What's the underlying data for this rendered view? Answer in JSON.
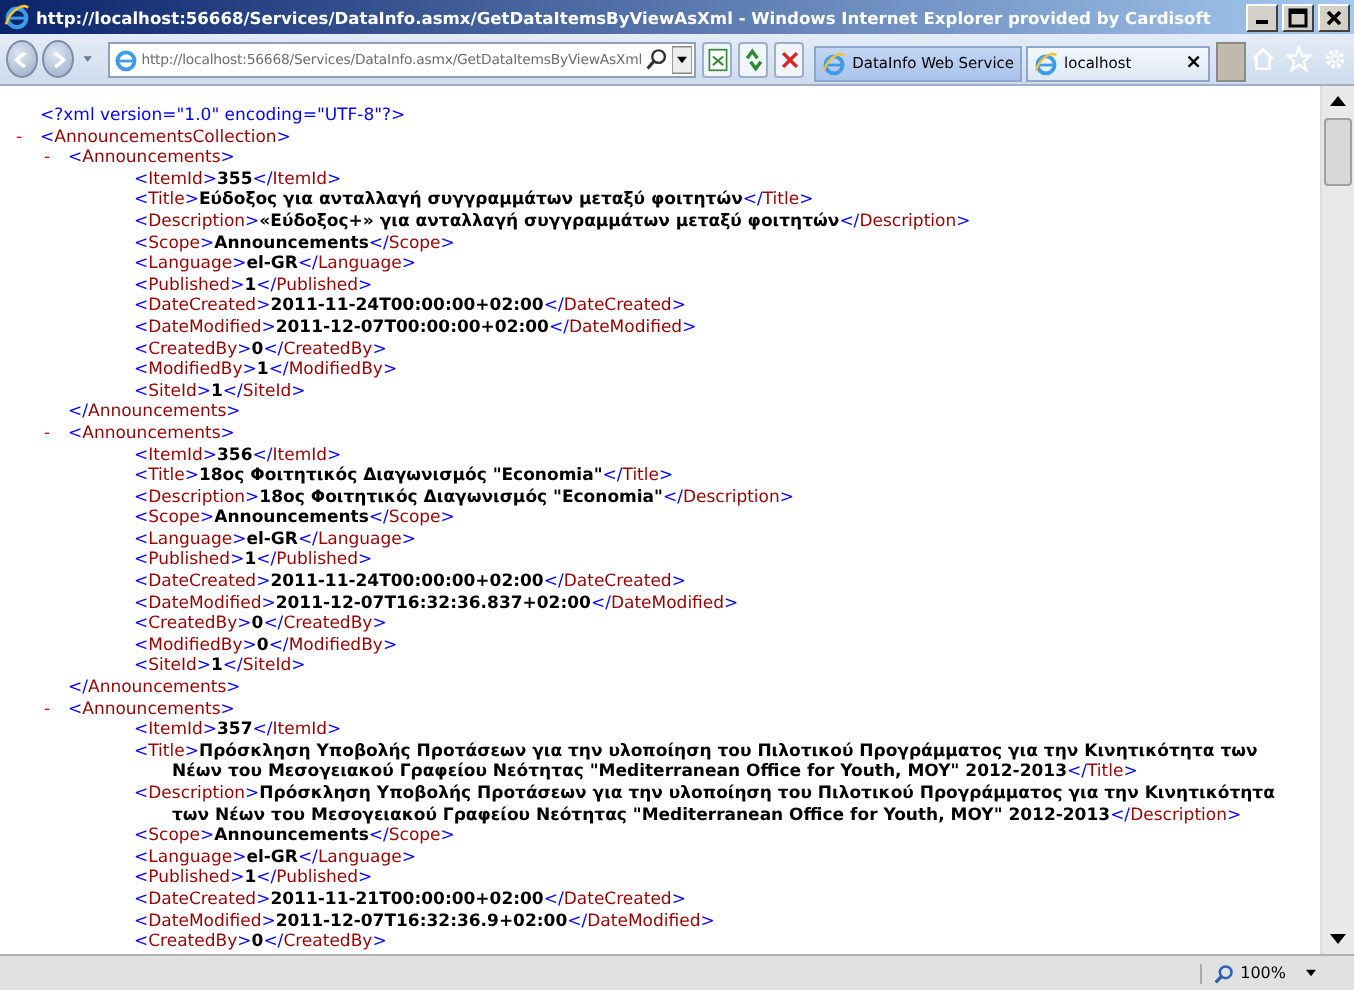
{
  "window": {
    "title": "http://localhost:56668/Services/DataInfo.asmx/GetDataItemsByViewAsXml - Windows Internet Explorer provided by Cardisoft"
  },
  "toolbar": {
    "address": "http://localhost:56668/Services/DataInfo.asmx/GetDataItemsByViewAsXml",
    "tabs": [
      {
        "label": "DataInfo Web Service",
        "selected": false
      },
      {
        "label": "localhost",
        "selected": true,
        "close": "×"
      }
    ]
  },
  "document": {
    "declaration": "<?xml version=\"1.0\" encoding=\"UTF-8\"?>",
    "root": {
      "toggle": "-",
      "open": "<AnnouncementsCollection>",
      "items": [
        {
          "toggle": "-",
          "open": "<Announcements>",
          "close": "</Announcements>",
          "fields": [
            {
              "open": "<ItemId>",
              "value": "355",
              "close": "</ItemId>"
            },
            {
              "open": "<Title>",
              "value": "Εύδοξος για ανταλλαγή συγγραμμάτων μεταξύ φοιτητών",
              "close": "</Title>"
            },
            {
              "open": "<Description>",
              "value": "«Εύδοξος+» για ανταλλαγή συγγραμμάτων μεταξύ φοιτητών",
              "close": "</Description>"
            },
            {
              "open": "<Scope>",
              "value": "Announcements",
              "close": "</Scope>"
            },
            {
              "open": "<Language>",
              "value": "el-GR",
              "close": "</Language>"
            },
            {
              "open": "<Published>",
              "value": "1",
              "close": "</Published>"
            },
            {
              "open": "<DateCreated>",
              "value": "2011-11-24T00:00:00+02:00",
              "close": "</DateCreated>"
            },
            {
              "open": "<DateModified>",
              "value": "2011-12-07T00:00:00+02:00",
              "close": "</DateModified>"
            },
            {
              "open": "<CreatedBy>",
              "value": "0",
              "close": "</CreatedBy>"
            },
            {
              "open": "<ModifiedBy>",
              "value": "1",
              "close": "</ModifiedBy>"
            },
            {
              "open": "<SiteId>",
              "value": "1",
              "close": "</SiteId>"
            }
          ]
        },
        {
          "toggle": "-",
          "open": "<Announcements>",
          "close": "</Announcements>",
          "fields": [
            {
              "open": "<ItemId>",
              "value": "356",
              "close": "</ItemId>"
            },
            {
              "open": "<Title>",
              "value": "18ος Φοιτητικός Διαγωνισμός \"Economia\"",
              "close": "</Title>"
            },
            {
              "open": "<Description>",
              "value": "18ος Φοιτητικός Διαγωνισμός \"Economia\"",
              "close": "</Description>"
            },
            {
              "open": "<Scope>",
              "value": "Announcements",
              "close": "</Scope>"
            },
            {
              "open": "<Language>",
              "value": "el-GR",
              "close": "</Language>"
            },
            {
              "open": "<Published>",
              "value": "1",
              "close": "</Published>"
            },
            {
              "open": "<DateCreated>",
              "value": "2011-11-24T00:00:00+02:00",
              "close": "</DateCreated>"
            },
            {
              "open": "<DateModified>",
              "value": "2011-12-07T16:32:36.837+02:00",
              "close": "</DateModified>"
            },
            {
              "open": "<CreatedBy>",
              "value": "0",
              "close": "</CreatedBy>"
            },
            {
              "open": "<ModifiedBy>",
              "value": "0",
              "close": "</ModifiedBy>"
            },
            {
              "open": "<SiteId>",
              "value": "1",
              "close": "</SiteId>"
            }
          ]
        },
        {
          "toggle": "-",
          "open": "<Announcements>",
          "fields": [
            {
              "open": "<ItemId>",
              "value": "357",
              "close": "</ItemId>"
            },
            {
              "open": "<Title>",
              "value": "Πρόσκληση Υποβολής Προτάσεων για την υλοποίηση του Πιλοτικού Προγράμματος για την Κινητικότητα των Νέων του Μεσογειακού Γραφείου Νεότητας \"Mediterranean Office for Youth, MOY\" 2012-2013",
              "close": "</Title>"
            },
            {
              "open": "<Description>",
              "value": "Πρόσκληση Υποβολής Προτάσεων για την υλοποίηση του Πιλοτικού Προγράμματος για την Κινητικότητα των Νέων του Μεσογειακού Γραφείου Νεότητας \"Mediterranean Office for Youth, MOY\" 2012-2013",
              "close": "</Description>"
            },
            {
              "open": "<Scope>",
              "value": "Announcements",
              "close": "</Scope>"
            },
            {
              "open": "<Language>",
              "value": "el-GR",
              "close": "</Language>"
            },
            {
              "open": "<Published>",
              "value": "1",
              "close": "</Published>"
            },
            {
              "open": "<DateCreated>",
              "value": "2011-11-21T00:00:00+02:00",
              "close": "</DateCreated>"
            },
            {
              "open": "<DateModified>",
              "value": "2011-12-07T16:32:36.9+02:00",
              "close": "</DateModified>"
            },
            {
              "open": "<CreatedBy>",
              "value": "0",
              "close": "</CreatedBy>"
            }
          ]
        }
      ]
    }
  },
  "status_bar": {
    "zoom": "100%"
  }
}
